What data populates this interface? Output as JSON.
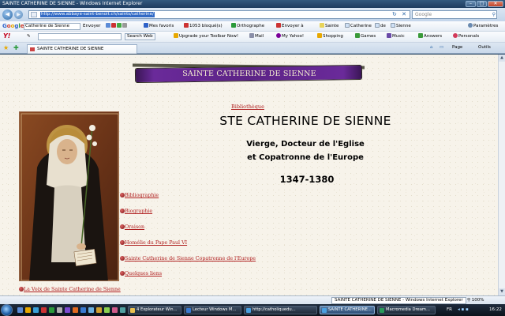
{
  "window": {
    "title": "SAINTE CATHERINE DE SIENNE - Windows Internet Explorer",
    "minimize": "–",
    "maximize": "□",
    "close": "✕"
  },
  "address_bar": {
    "url": "http://www.abbaye-saint-benoit.ch/saints/catherine/",
    "buttons": "↻ ✕",
    "search_placeholder": "Google"
  },
  "google_toolbar": {
    "logo": "Google",
    "query": "Catherine de Sienne",
    "items": [
      "Envoyer",
      "Mes favoris",
      "1053 bloqué(s)",
      "Orthographe",
      "Envoyer à",
      "Sainte",
      "Catherine",
      "de",
      "Sienne",
      "Paramètres"
    ]
  },
  "yahoo_toolbar": {
    "logo": "Y!",
    "search_button": "Search Web",
    "items": [
      "Upgrade your Toolbar Now!",
      "Mail",
      "My Yahoo!",
      "Shopping",
      "Games",
      "Music",
      "Answers",
      "Personals"
    ]
  },
  "tab": {
    "label": "SAINTE CATHERINE DE SIENNE"
  },
  "command_bar": {
    "items": [
      "Page",
      "Outils"
    ]
  },
  "page": {
    "banner_title": "SAINTE CATHERINE DE SIENNE",
    "biblio_link": "Bibliothèque",
    "title": "STE CATHERINE DE SIENNE",
    "subtitle_line1": "Vierge, Docteur de l'Eglise",
    "subtitle_line2": "et Copatronne de l'Europe",
    "dates": "1347-1380",
    "menu": [
      "Bibliographie",
      "Biographie",
      "Oraison",
      "Homélie du Pape Paul VI",
      "Sainte Catherine de Sienne Copatronne de l'Europe",
      "Quelques liens"
    ],
    "voix_link": "La Voix de Sainte Catherine de Sienne"
  },
  "status_bar": {
    "text": "SAINTE CATHERINE DE SIENNE - Windows Internet Explorer",
    "zoom": "100%"
  },
  "taskbar": {
    "tasks": [
      "4 Explorateur Win...",
      "Lecteur Windows M...",
      "http://catholiquedu...",
      "SAINTE CATHERINE...",
      "Macromedia Dream..."
    ],
    "language": "FR",
    "clock": "16:22"
  },
  "colors": {
    "link": "#b02020",
    "banner": "#5c2386",
    "page_bg": "#f7f3ea"
  }
}
